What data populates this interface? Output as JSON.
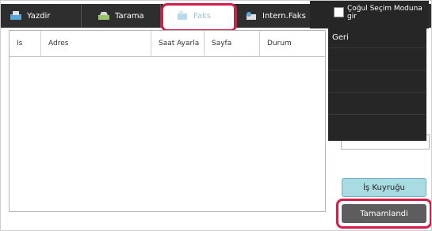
{
  "tabs": [
    {
      "label": "Yazdir",
      "icon": "print-icon"
    },
    {
      "label": "Tarama",
      "icon": "scan-icon"
    },
    {
      "label": "Faks",
      "icon": "fax-icon"
    },
    {
      "label": "Intern.Faks",
      "icon": "internet-fax-icon"
    }
  ],
  "nav": {
    "next_arrow": ">"
  },
  "table": {
    "columns": [
      "Is",
      "Adres",
      "Saat Ayarla",
      "Sayfa",
      "Durum"
    ]
  },
  "menu": {
    "multi_select_label": "Çoğul Seçim Moduna gir",
    "back_label": "Geri"
  },
  "buttons": {
    "queue_label": "İş Kuyruğu",
    "done_label": "Tamamlandi"
  },
  "colors": {
    "highlight": "#d21f4a",
    "tab_bar": "#2e2e2e",
    "queue_button": "#a9dbe3",
    "done_button": "#5d5d5d"
  }
}
